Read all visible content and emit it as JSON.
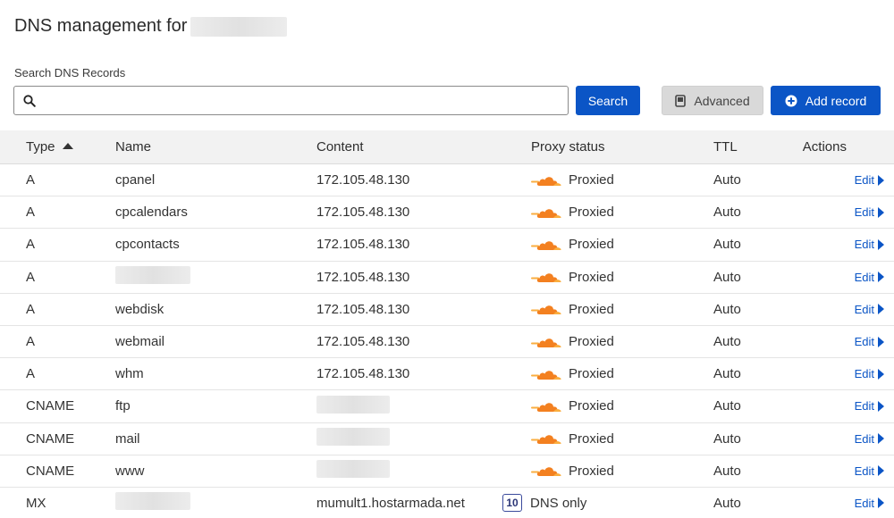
{
  "header": {
    "title": "DNS management for"
  },
  "search": {
    "label": "Search DNS Records",
    "value": "",
    "placeholder": ""
  },
  "buttons": {
    "search": "Search",
    "advanced": "Advanced",
    "add_record": "Add record"
  },
  "columns": {
    "type": "Type",
    "name": "Name",
    "content": "Content",
    "proxy": "Proxy status",
    "ttl": "TTL",
    "actions": "Actions"
  },
  "colors": {
    "primary": "#0b55c6",
    "cloud_orange": "#f38020",
    "cloud_light": "#faae40"
  },
  "records": [
    {
      "type": "A",
      "name": "cpanel",
      "content": "172.105.48.130",
      "proxy": "Proxied",
      "ttl": "Auto",
      "action": "Edit"
    },
    {
      "type": "A",
      "name": "cpcalendars",
      "content": "172.105.48.130",
      "proxy": "Proxied",
      "ttl": "Auto",
      "action": "Edit"
    },
    {
      "type": "A",
      "name": "cpcontacts",
      "content": "172.105.48.130",
      "proxy": "Proxied",
      "ttl": "Auto",
      "action": "Edit"
    },
    {
      "type": "A",
      "name": "",
      "content": "172.105.48.130",
      "proxy": "Proxied",
      "ttl": "Auto",
      "action": "Edit"
    },
    {
      "type": "A",
      "name": "webdisk",
      "content": "172.105.48.130",
      "proxy": "Proxied",
      "ttl": "Auto",
      "action": "Edit"
    },
    {
      "type": "A",
      "name": "webmail",
      "content": "172.105.48.130",
      "proxy": "Proxied",
      "ttl": "Auto",
      "action": "Edit"
    },
    {
      "type": "A",
      "name": "whm",
      "content": "172.105.48.130",
      "proxy": "Proxied",
      "ttl": "Auto",
      "action": "Edit"
    },
    {
      "type": "CNAME",
      "name": "ftp",
      "content": "",
      "proxy": "Proxied",
      "ttl": "Auto",
      "action": "Edit"
    },
    {
      "type": "CNAME",
      "name": "mail",
      "content": "",
      "proxy": "Proxied",
      "ttl": "Auto",
      "action": "Edit"
    },
    {
      "type": "CNAME",
      "name": "www",
      "content": "",
      "proxy": "Proxied",
      "ttl": "Auto",
      "action": "Edit"
    },
    {
      "type": "MX",
      "name": "",
      "content": "mumult1.hostarmada.net",
      "priority": "10",
      "proxy": "DNS only",
      "ttl": "Auto",
      "action": "Edit"
    }
  ]
}
